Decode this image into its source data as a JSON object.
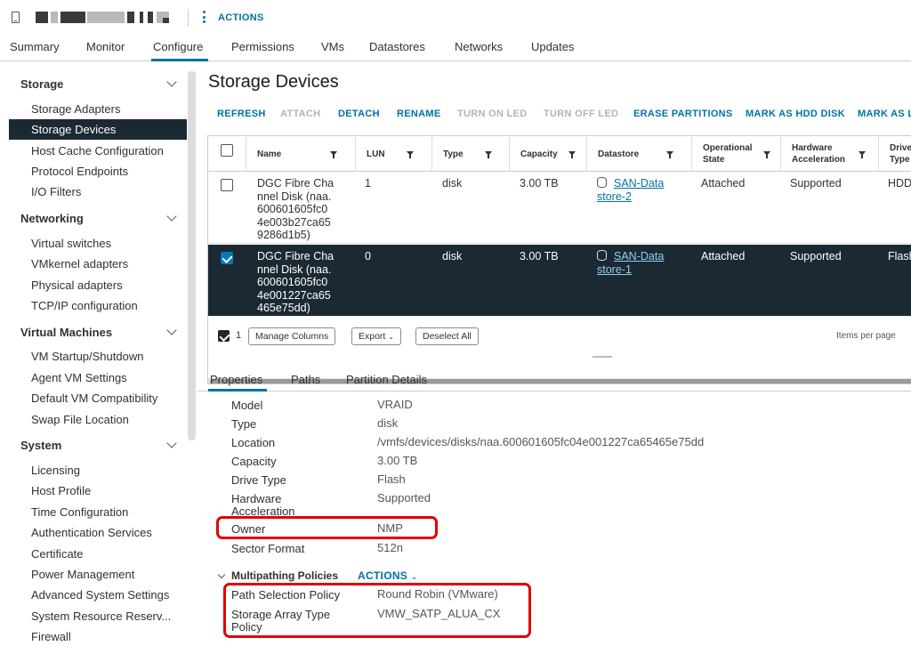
{
  "header": {
    "actions_label": "ACTIONS"
  },
  "tabs": [
    "Summary",
    "Monitor",
    "Configure",
    "Permissions",
    "VMs",
    "Datastores",
    "Networks",
    "Updates"
  ],
  "sidebar": {
    "sections": [
      {
        "title": "Storage",
        "items": [
          "Storage Adapters",
          "Storage Devices",
          "Host Cache Configuration",
          "Protocol Endpoints",
          "I/O Filters"
        ]
      },
      {
        "title": "Networking",
        "items": [
          "Virtual switches",
          "VMkernel adapters",
          "Physical adapters",
          "TCP/IP configuration"
        ]
      },
      {
        "title": "Virtual Machines",
        "items": [
          "VM Startup/Shutdown",
          "Agent VM Settings",
          "Default VM Compatibility",
          "Swap File Location"
        ]
      },
      {
        "title": "System",
        "items": [
          "Licensing",
          "Host Profile",
          "Time Configuration",
          "Authentication Services",
          "Certificate",
          "Power Management",
          "Advanced System Settings",
          "System Resource Reserv...",
          "Firewall"
        ]
      }
    ],
    "selected": "Storage Devices"
  },
  "page_title": "Storage Devices",
  "toolbar": [
    "REFRESH",
    "ATTACH",
    "DETACH",
    "RENAME",
    "TURN ON LED",
    "TURN OFF LED",
    "ERASE PARTITIONS",
    "MARK AS HDD DISK",
    "MARK AS LO"
  ],
  "grid": {
    "columns": {
      "name": "Name",
      "lun": "LUN",
      "type": "Type",
      "capacity": "Capacity",
      "datastore": "Datastore",
      "opstate_1": "Operational",
      "opstate_2": "State",
      "hwaccel_1": "Hardware",
      "hwaccel_2": "Acceleration",
      "drive_1": "Drive",
      "drive_2": "Type"
    },
    "rows": [
      {
        "name": [
          "DGC Fibre Cha",
          "nnel Disk (naa.",
          "600601605fc0",
          "4e003b27ca65",
          "9286d1b5)"
        ],
        "lun": "1",
        "type": "disk",
        "capacity": "3.00 TB",
        "datastore": [
          "SAN-Data",
          "store-2"
        ],
        "opstate": "Attached",
        "hwaccel": "Supported",
        "drive": "HDD"
      },
      {
        "name": [
          "DGC Fibre Cha",
          "nnel Disk (naa.",
          "600601605fc0",
          "4e001227ca65",
          "465e75dd)"
        ],
        "lun": "0",
        "type": "disk",
        "capacity": "3.00 TB",
        "datastore": [
          "SAN-Data",
          "store-1"
        ],
        "opstate": "Attached",
        "hwaccel": "Supported",
        "drive": "Flash"
      }
    ],
    "footer": {
      "selected_count": "1",
      "manage_columns": "Manage Columns",
      "export": "Export",
      "deselect_all": "Deselect All",
      "items_per_page": "Items per page"
    }
  },
  "subtabs": [
    "Properties",
    "Paths",
    "Partition Details"
  ],
  "properties": {
    "model": {
      "label": "Model",
      "value": "VRAID"
    },
    "type": {
      "label": "Type",
      "value": "disk"
    },
    "location": {
      "label": "Location",
      "value": "/vmfs/devices/disks/naa.600601605fc04e001227ca65465e75dd"
    },
    "capacity": {
      "label": "Capacity",
      "value": "3.00 TB"
    },
    "drive_type": {
      "label": "Drive Type",
      "value": "Flash"
    },
    "hw_accel": {
      "label_1": "Hardware",
      "label_2": "Acceleration",
      "value": "Supported"
    },
    "owner": {
      "label": "Owner",
      "value": "NMP"
    },
    "sector_format": {
      "label": "Sector Format",
      "value": "512n"
    }
  },
  "multipathing": {
    "title": "Multipathing Policies",
    "actions": "ACTIONS",
    "psp": {
      "label": "Path Selection Policy",
      "value": "Round Robin (VMware)"
    },
    "satp": {
      "label_1": "Storage Array Type",
      "label_2": "Policy",
      "value": "VMW_SATP_ALUA_CX"
    }
  },
  "colors": {
    "accent": "#0072a3",
    "selected_bg": "#1b2a32",
    "highlight": "#e10000"
  }
}
